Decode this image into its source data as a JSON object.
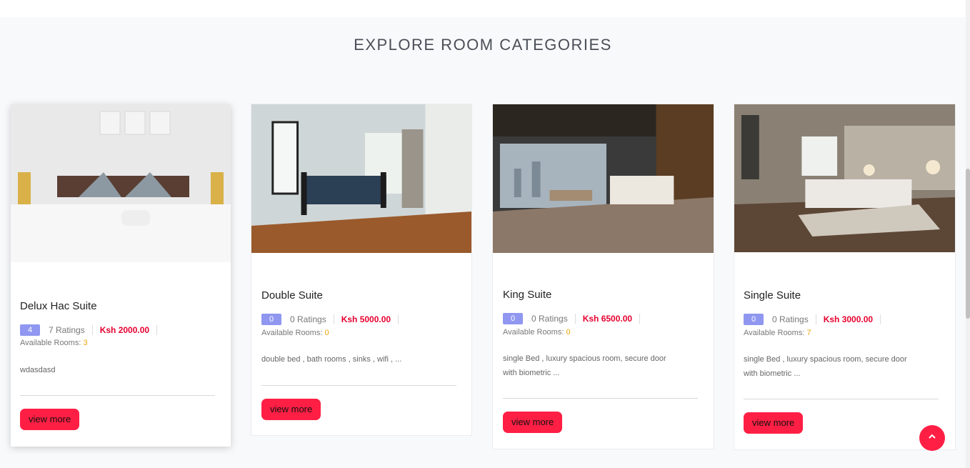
{
  "section": {
    "title": "EXPLORE ROOM CATEGORIES"
  },
  "cards": [
    {
      "name": "Delux Hac Suite",
      "rating": "4",
      "ratings_text": "7 Ratings",
      "price": "Ksh 2000.00",
      "available_label": "Available Rooms:",
      "available_count": "3",
      "description": "wdasdasd",
      "button": "view more"
    },
    {
      "name": "Double Suite",
      "rating": "0",
      "ratings_text": "0 Ratings",
      "price": "Ksh 5000.00",
      "available_label": "Available Rooms:",
      "available_count": "0",
      "description": "double bed , bath rooms , sinks , wifi , ...",
      "button": "view more"
    },
    {
      "name": "King Suite",
      "rating": "0",
      "ratings_text": "0 Ratings",
      "price": "Ksh 6500.00",
      "available_label": "Available Rooms:",
      "available_count": "0",
      "description": "single Bed , luxury spacious room, secure door with biometric ...",
      "button": "view more"
    },
    {
      "name": "Single Suite",
      "rating": "0",
      "ratings_text": "0 Ratings",
      "price": "Ksh 3000.00",
      "available_label": "Available Rooms:",
      "available_count": "7",
      "description": "single Bed , luxury spacious room, secure door with biometric ...",
      "button": "view more"
    }
  ],
  "icons": {
    "scroll_top": "chevron-up-icon",
    "room_photo": "room-photo"
  },
  "colors": {
    "accent": "#ff1f44",
    "badge": "#8f97f0",
    "price": "#e6002e",
    "available": "#f0a30a"
  }
}
